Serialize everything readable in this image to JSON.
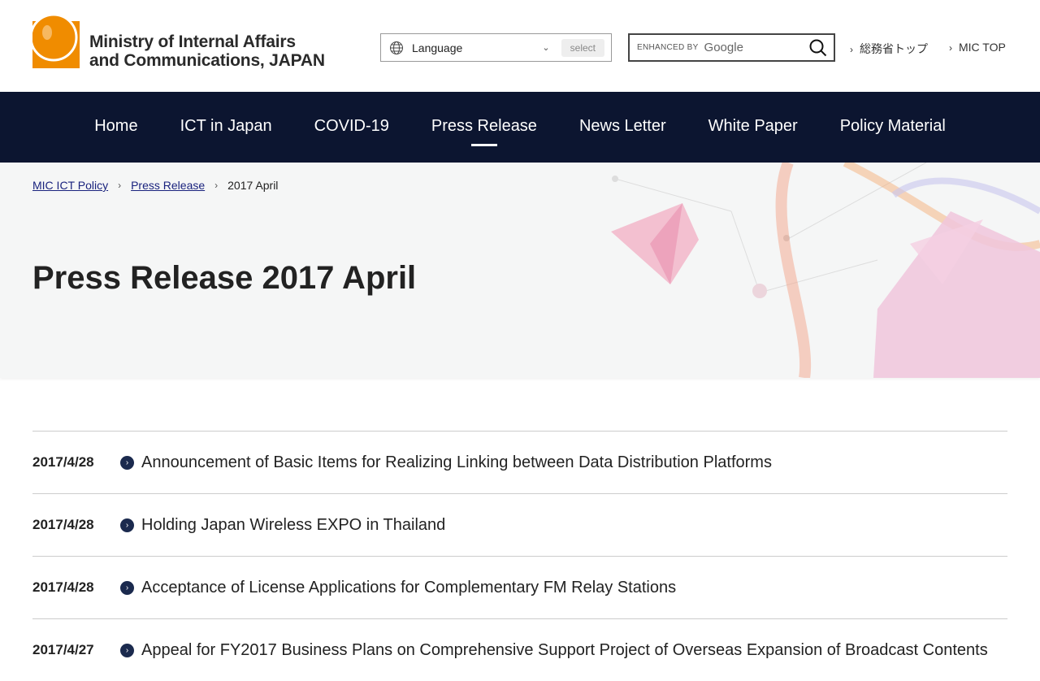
{
  "header": {
    "logo_line1": "Ministry of Internal Affairs",
    "logo_line2": "and Communications, JAPAN",
    "language_label": "Language",
    "language_select": "select",
    "search_enhanced": "ENHANCED BY",
    "search_google": "Google",
    "link_jp": "総務省トップ",
    "link_mic": "MIC TOP"
  },
  "nav": [
    "Home",
    "ICT in Japan",
    "COVID-19",
    "Press Release",
    "News Letter",
    "White Paper",
    "Policy Material"
  ],
  "breadcrumb": [
    "MIC ICT Policy",
    "Press Release",
    "2017 April"
  ],
  "page_title": "Press Release 2017 April",
  "items": [
    {
      "date": "2017/4/28",
      "title": "Announcement of Basic Items for Realizing Linking between Data Distribution Platforms"
    },
    {
      "date": "2017/4/28",
      "title": "Holding Japan Wireless EXPO in Thailand"
    },
    {
      "date": "2017/4/28",
      "title": "Acceptance of License Applications for Complementary FM Relay Stations"
    },
    {
      "date": "2017/4/27",
      "title": "Appeal for FY2017 Business Plans on Comprehensive Support Project of Overseas Expansion of Broadcast Contents"
    }
  ],
  "colors": {
    "nav_bg": "#0c1530",
    "logo_orange": "#f08c00"
  }
}
